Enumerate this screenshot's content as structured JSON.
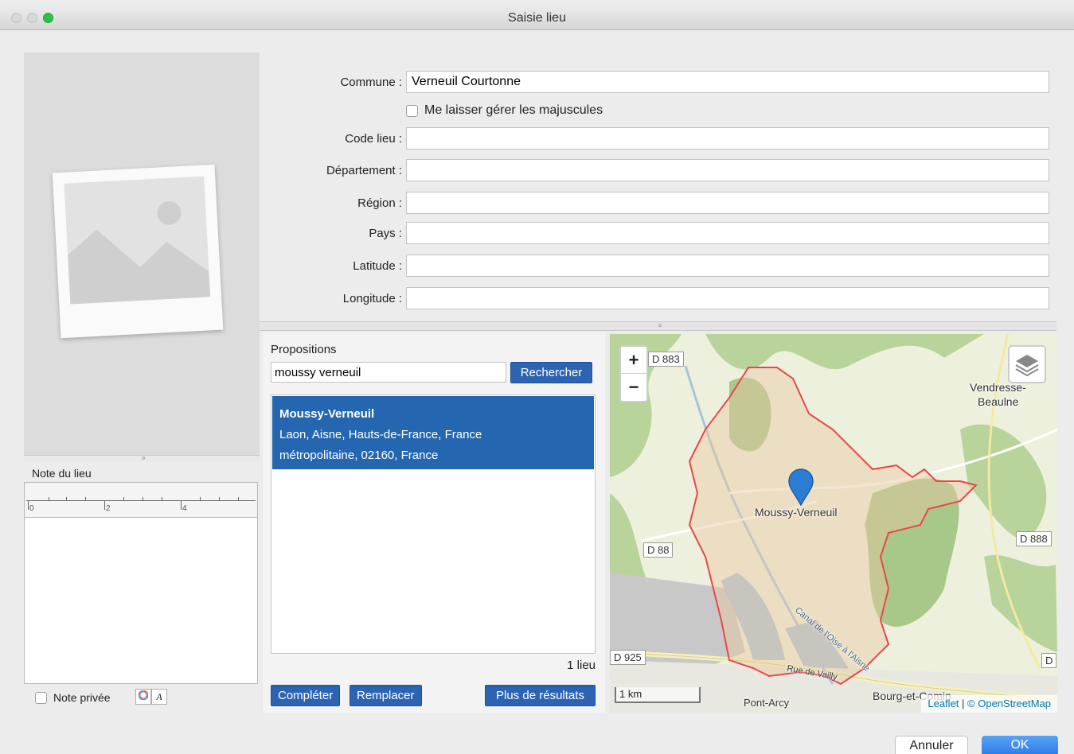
{
  "window": {
    "title": "Saisie lieu"
  },
  "form": {
    "commune_label": "Commune :",
    "commune_value": "Verneuil Courtonne",
    "caps_label": "Me laisser gérer les majuscules",
    "code_label": "Code lieu :",
    "departement_label": "Département :",
    "region_label": "Région :",
    "pays_label": "Pays :",
    "latitude_label": "Latitude :",
    "longitude_label": "Longitude :"
  },
  "left": {
    "note_label": "Note du lieu",
    "ruler_numbers": [
      "0",
      "2",
      "4"
    ],
    "private_label": "Note privée"
  },
  "propositions": {
    "title": "Propositions",
    "search_value": "moussy verneuil",
    "search_button": "Rechercher",
    "result": {
      "title": "Moussy-Verneuil",
      "line1": "Laon, Aisne, Hauts-de-France, France",
      "line2": "métropolitaine, 02160, France"
    },
    "count": "1 lieu",
    "complete_button": "Compléter",
    "replace_button": "Remplacer",
    "more_button": "Plus de résultats"
  },
  "map": {
    "zoom_in": "+",
    "zoom_out": "−",
    "marker_label": "Moussy-Verneuil",
    "roads": [
      "D 883",
      "D 88",
      "D 888",
      "D 925",
      "D"
    ],
    "places": [
      "Vendresse-",
      "Beaulne",
      "Pont-Arcy",
      "Bourg-et-Comin",
      "Canal de l'Oise à l'Aisne",
      "Rue de Vailly"
    ],
    "scale": "1 km",
    "attribution_leaflet": "Leaflet",
    "attribution_osm": "© OpenStreetMap",
    "colors": {
      "boundary": "#e8474b",
      "marker": "#2a7dd3",
      "forest": "#a8c88a"
    }
  },
  "footer": {
    "cancel": "Annuler",
    "ok": "OK"
  }
}
